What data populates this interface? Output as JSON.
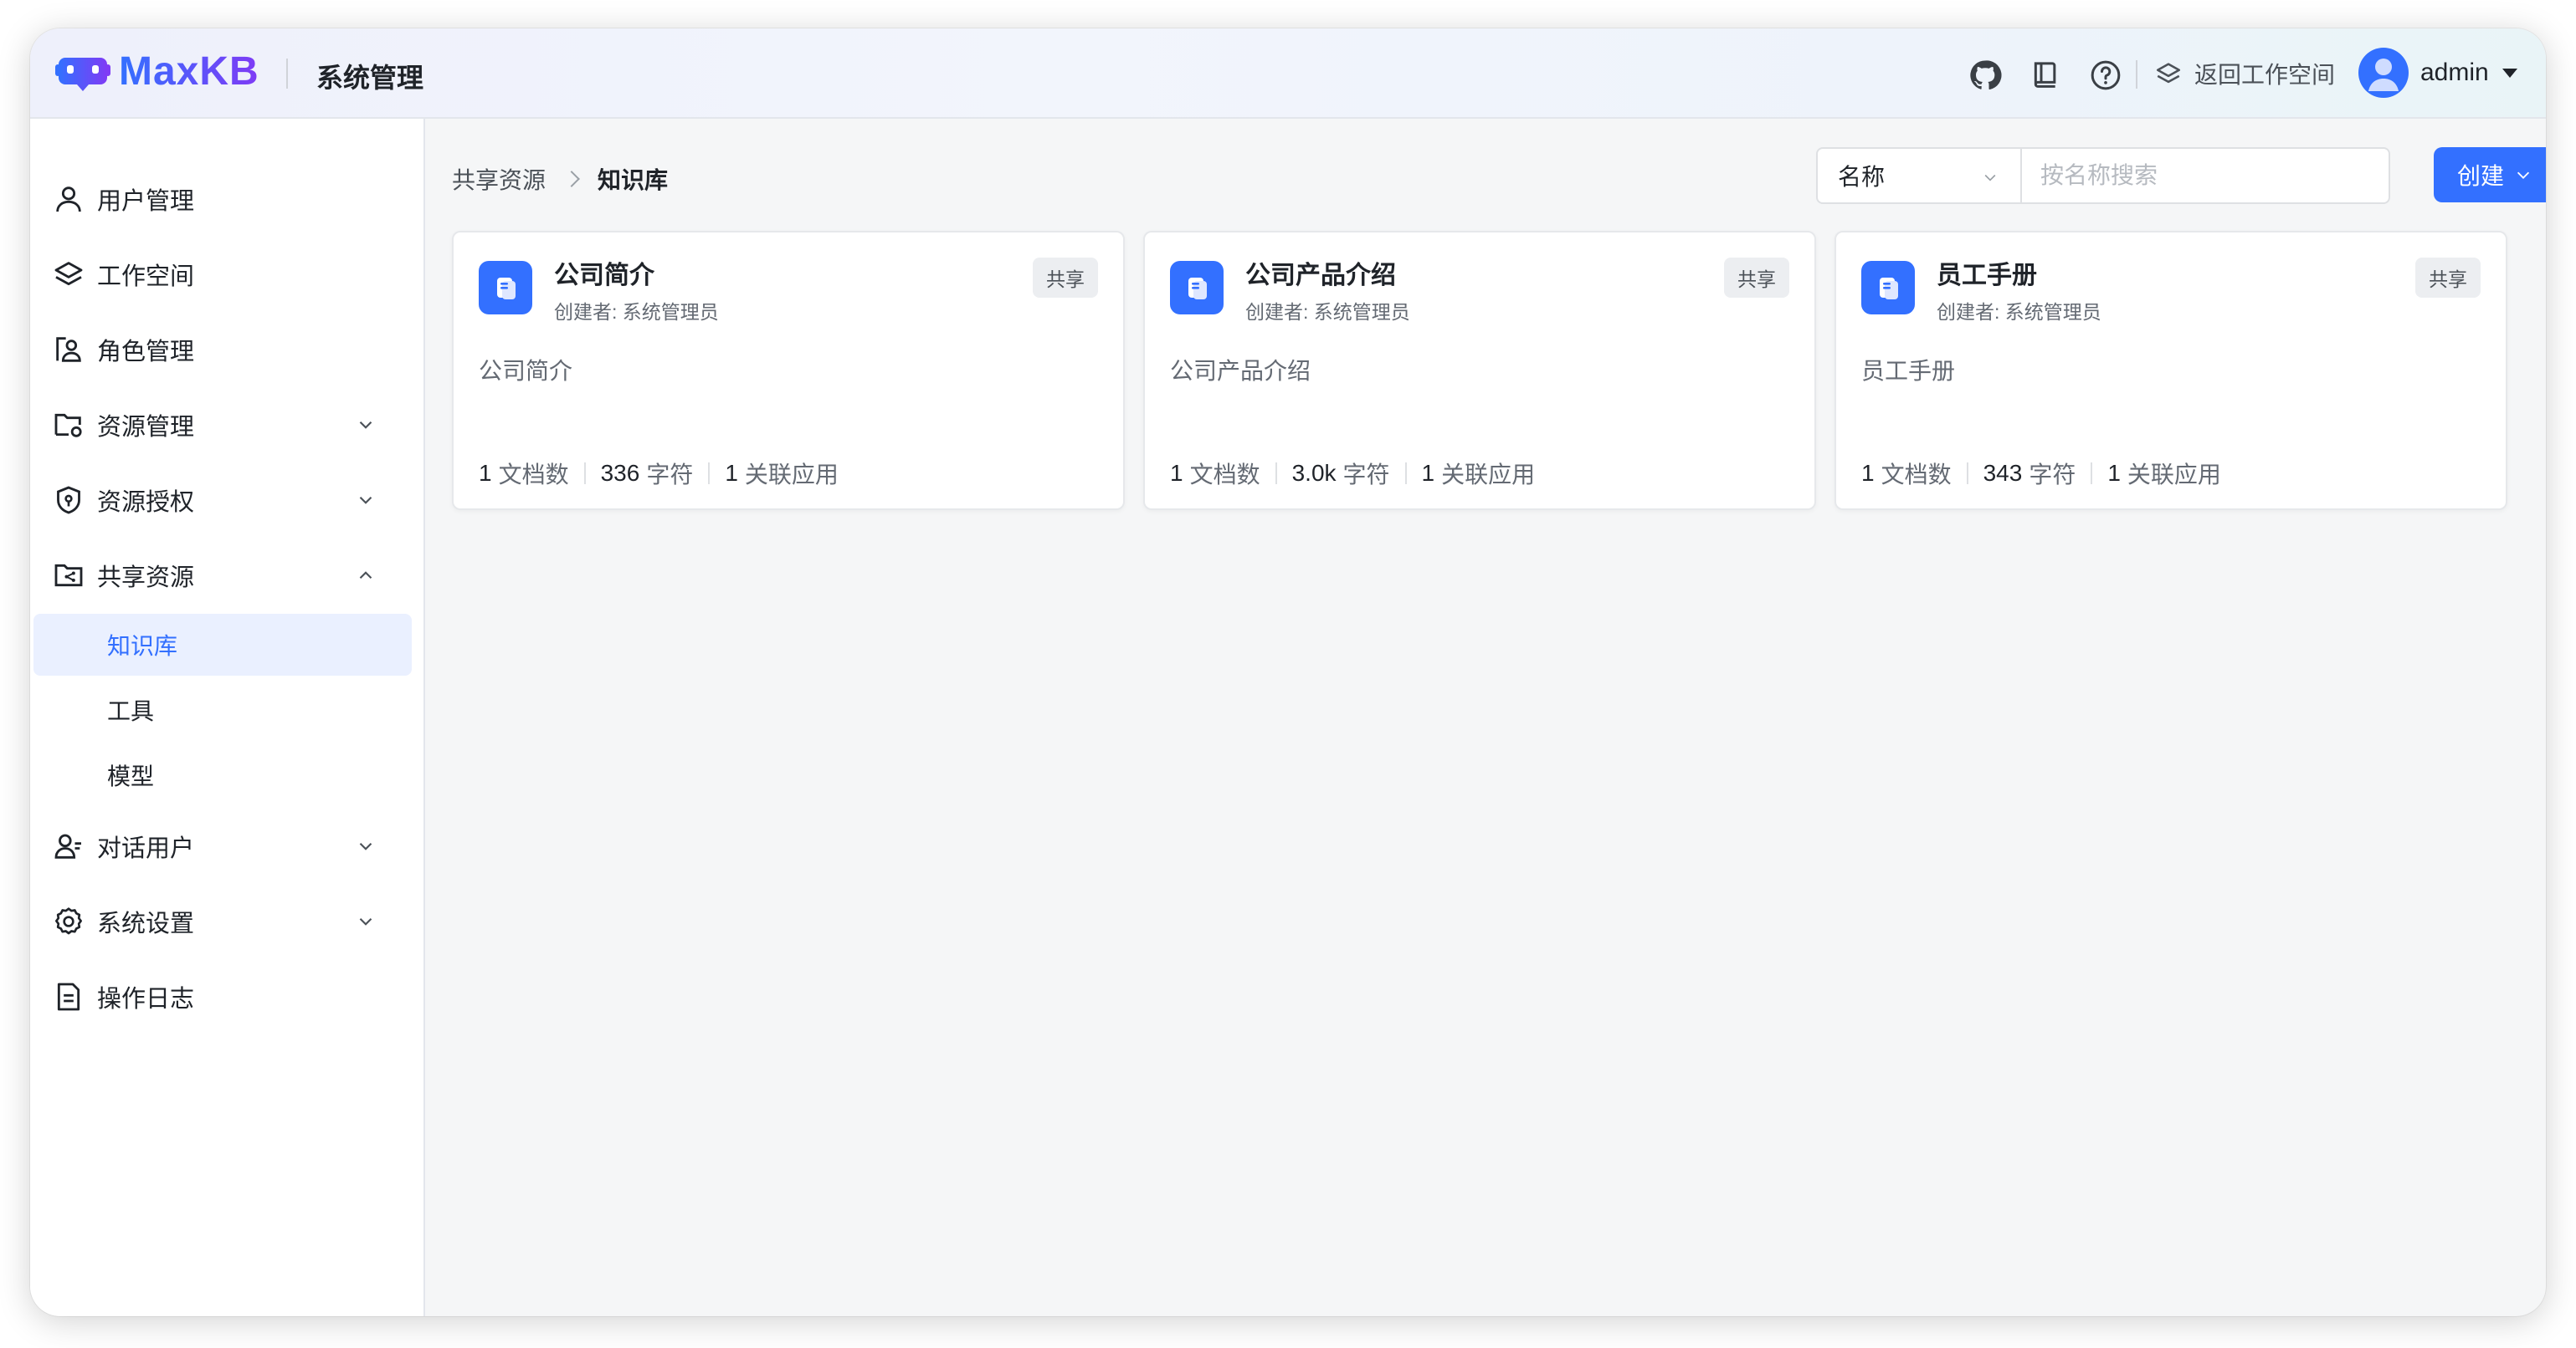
{
  "app": {
    "brand": "MaxKB",
    "section_title": "系统管理"
  },
  "header": {
    "back_to_workspace": "返回工作空间",
    "username": "admin"
  },
  "sidebar": {
    "items": [
      {
        "label": "用户管理",
        "icon": "user-icon"
      },
      {
        "label": "工作空间",
        "icon": "layers-icon"
      },
      {
        "label": "角色管理",
        "icon": "role-icon"
      },
      {
        "label": "资源管理",
        "icon": "folder-gear-icon",
        "expandable": true,
        "expanded": false
      },
      {
        "label": "资源授权",
        "icon": "shield-icon",
        "expandable": true,
        "expanded": false
      },
      {
        "label": "共享资源",
        "icon": "folder-share-icon",
        "expandable": true,
        "expanded": true
      },
      {
        "label": "对话用户",
        "icon": "chat-user-icon",
        "expandable": true,
        "expanded": false
      },
      {
        "label": "系统设置",
        "icon": "gear-icon",
        "expandable": true,
        "expanded": false
      },
      {
        "label": "操作日志",
        "icon": "document-icon"
      }
    ],
    "shared_children": [
      {
        "label": "知识库",
        "active": true
      },
      {
        "label": "工具",
        "active": false
      },
      {
        "label": "模型",
        "active": false
      }
    ]
  },
  "breadcrumb": {
    "parent": "共享资源",
    "current": "知识库"
  },
  "filter": {
    "field": "名称",
    "search_placeholder": "按名称搜索",
    "search_value": ""
  },
  "create_button": "创建",
  "cards": [
    {
      "title": "公司简介",
      "creator": "创建者: 系统管理员",
      "badge": "共享",
      "description": "公司简介",
      "docs": "1",
      "docs_label": "文档数",
      "chars": "336",
      "chars_label": "字符",
      "apps": "1",
      "apps_label": "关联应用"
    },
    {
      "title": "公司产品介绍",
      "creator": "创建者: 系统管理员",
      "badge": "共享",
      "description": "公司产品介绍",
      "docs": "1",
      "docs_label": "文档数",
      "chars": "3.0k",
      "chars_label": "字符",
      "apps": "1",
      "apps_label": "关联应用"
    },
    {
      "title": "员工手册",
      "creator": "创建者: 系统管理员",
      "badge": "共享",
      "description": "员工手册",
      "docs": "1",
      "docs_label": "文档数",
      "chars": "343",
      "chars_label": "字符",
      "apps": "1",
      "apps_label": "关联应用"
    }
  ],
  "colors": {
    "accent": "#3370ff",
    "active_bg": "#eaf0ff",
    "page_bg": "#f5f6f7"
  }
}
